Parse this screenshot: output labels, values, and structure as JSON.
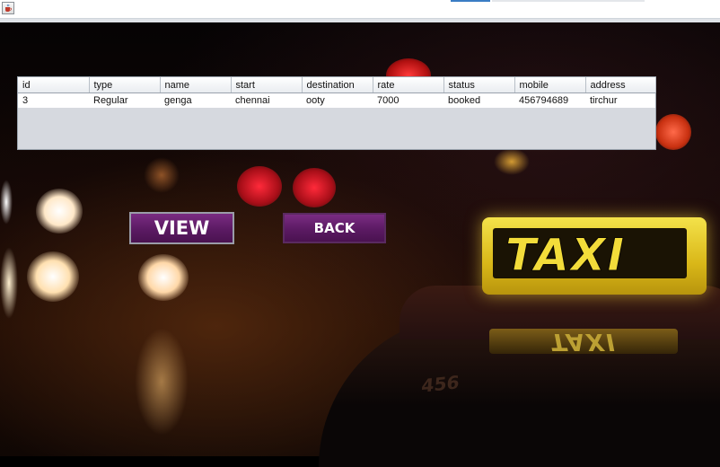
{
  "window": {
    "icon": "java-cup-icon"
  },
  "table": {
    "columns": [
      "id",
      "type",
      "name",
      "start",
      "destination",
      "rate",
      "status",
      "mobile",
      "address"
    ],
    "rows": [
      [
        "3",
        "Regular",
        "genga",
        "chennai",
        "ooty",
        "7000",
        "booked",
        "456794689",
        "tirchur"
      ]
    ]
  },
  "buttons": {
    "view_label": "VIEW",
    "back_label": "BACK"
  },
  "background": {
    "sign_text": "TAXI",
    "car_number": "456"
  },
  "colors": {
    "button_purple": "#5b1a63",
    "taxi_yellow": "#f3dc3a"
  }
}
